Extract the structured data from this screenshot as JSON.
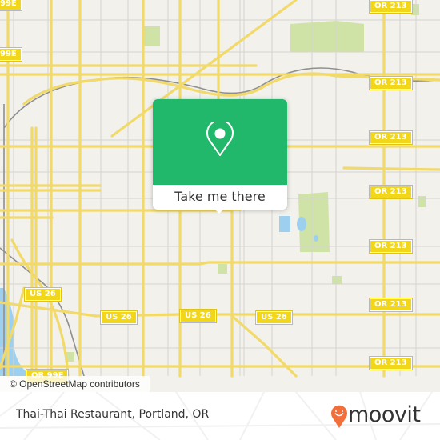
{
  "map": {
    "route_shields": [
      {
        "label": "OR 213"
      },
      {
        "label": "OR 213"
      },
      {
        "label": "OR 213"
      },
      {
        "label": "OR 213"
      },
      {
        "label": "OR 213"
      },
      {
        "label": "OR 213"
      },
      {
        "label": "OR 213"
      },
      {
        "label": "US 26"
      },
      {
        "label": "US 26"
      },
      {
        "label": "US 26"
      },
      {
        "label": "US 26"
      },
      {
        "label": "OR 99E"
      },
      {
        "label": "99E"
      },
      {
        "label": "99E"
      }
    ],
    "attribution": "© OpenStreetMap contributors",
    "colors": {
      "land": "#f2f1ec",
      "road_major": "#f6e27a",
      "road_minor": "#d6d4cf",
      "park": "#cfe3a6",
      "water": "#9dd0ee",
      "shield": "#f1d619"
    }
  },
  "popup": {
    "button_label": "Take me there",
    "pin_icon": "map-pin-icon",
    "color": "#22b86b"
  },
  "footer": {
    "place_title": "Thai-Thai Restaurant, Portland, OR",
    "brand": "moovit",
    "brand_color": "#f26e3a"
  }
}
